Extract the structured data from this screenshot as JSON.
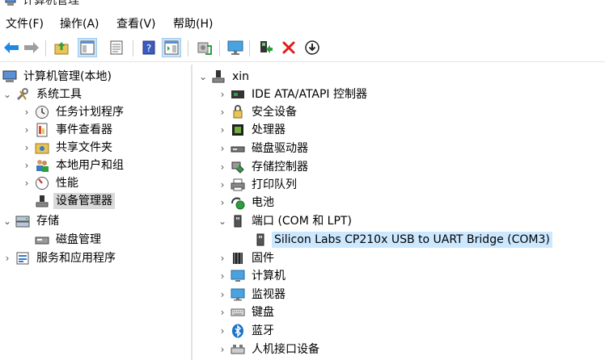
{
  "window": {
    "title": "计算机管理"
  },
  "menu": {
    "items": [
      "文件(F)",
      "操作(A)",
      "查看(V)",
      "帮助(H)"
    ]
  },
  "left_tree": {
    "items": [
      {
        "label": "计算机管理(本地)",
        "chevron": "",
        "icon": "computer-management-icon"
      },
      {
        "label": "系统工具",
        "chevron": "⌄",
        "icon": "tools-icon"
      },
      {
        "label": "任务计划程序",
        "chevron": "›",
        "icon": "clock-icon"
      },
      {
        "label": "事件查看器",
        "chevron": "›",
        "icon": "event-viewer-icon"
      },
      {
        "label": "共享文件夹",
        "chevron": "›",
        "icon": "shared-folder-icon"
      },
      {
        "label": "本地用户和组",
        "chevron": "›",
        "icon": "users-icon"
      },
      {
        "label": "性能",
        "chevron": "›",
        "icon": "performance-icon"
      },
      {
        "label": "设备管理器",
        "chevron": "",
        "icon": "device-manager-icon"
      },
      {
        "label": "存储",
        "chevron": "⌄",
        "icon": "storage-icon"
      },
      {
        "label": "磁盘管理",
        "chevron": "",
        "icon": "disk-management-icon"
      },
      {
        "label": "服务和应用程序",
        "chevron": "›",
        "icon": "services-icon"
      }
    ]
  },
  "device_tree": {
    "root": "xin",
    "items": [
      {
        "label": "IDE ATA/ATAPI 控制器",
        "chevron": "›",
        "icon": "ide-controller-icon"
      },
      {
        "label": "安全设备",
        "chevron": "›",
        "icon": "security-device-icon"
      },
      {
        "label": "处理器",
        "chevron": "›",
        "icon": "processor-icon"
      },
      {
        "label": "磁盘驱动器",
        "chevron": "›",
        "icon": "disk-drive-icon"
      },
      {
        "label": "存储控制器",
        "chevron": "›",
        "icon": "storage-controller-icon"
      },
      {
        "label": "打印队列",
        "chevron": "›",
        "icon": "printer-icon"
      },
      {
        "label": "电池",
        "chevron": "›",
        "icon": "battery-icon"
      },
      {
        "label": "端口 (COM 和 LPT)",
        "chevron": "⌄",
        "icon": "port-icon"
      },
      {
        "label": "Silicon Labs CP210x USB to UART Bridge (COM3)",
        "chevron": "",
        "icon": "port-icon"
      },
      {
        "label": "固件",
        "chevron": "›",
        "icon": "firmware-icon"
      },
      {
        "label": "计算机",
        "chevron": "›",
        "icon": "computer-icon"
      },
      {
        "label": "监视器",
        "chevron": "›",
        "icon": "monitor-icon"
      },
      {
        "label": "键盘",
        "chevron": "›",
        "icon": "keyboard-icon"
      },
      {
        "label": "蓝牙",
        "chevron": "›",
        "icon": "bluetooth-icon"
      },
      {
        "label": "人机接口设备",
        "chevron": "›",
        "icon": "hid-icon"
      }
    ]
  },
  "colors": {
    "selection_blue": "#cce8ff",
    "selection_gray": "#d9d9d9",
    "accent": "#1a73c8"
  }
}
